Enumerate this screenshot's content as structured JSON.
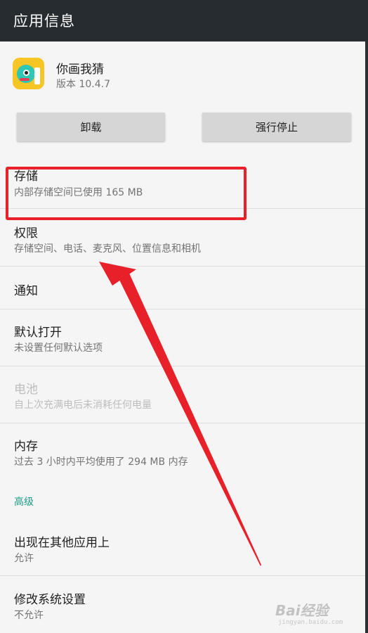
{
  "appbar": {
    "title": "应用信息"
  },
  "app": {
    "name": "你画我猜",
    "version": "版本 10.4.7",
    "icon": "app-icon"
  },
  "buttons": {
    "uninstall": "卸载",
    "force_stop": "强行停止"
  },
  "settings": [
    {
      "title": "存储",
      "summary": "内部存储空间已使用 165 MB",
      "enabled": true
    },
    {
      "title": "权限",
      "summary": "存储空间、电话、麦克风、位置信息和相机",
      "enabled": true,
      "highlighted": true
    },
    {
      "title": "通知",
      "summary": "",
      "enabled": true
    },
    {
      "title": "默认打开",
      "summary": "未设置任何默认选项",
      "enabled": true
    },
    {
      "title": "电池",
      "summary": "自上次充满电后未消耗任何电量",
      "enabled": false
    },
    {
      "title": "内存",
      "summary": "过去 3 小时内平均使用了 294 MB 内存",
      "enabled": true
    }
  ],
  "advanced": {
    "header": "高级",
    "items": [
      {
        "title": "出现在其他应用上",
        "summary": "允许"
      },
      {
        "title": "修改系统设置",
        "summary": "不允许"
      }
    ]
  },
  "annotation": {
    "highlight_color": "#e8202a",
    "arrow_color": "#e8202a"
  },
  "watermark": {
    "text": "Bai经验",
    "sub": "jingyan.baidu.com"
  },
  "colors": {
    "appbar": "#272c30",
    "accent": "#1e9e87",
    "background": "#f5f5f5"
  }
}
